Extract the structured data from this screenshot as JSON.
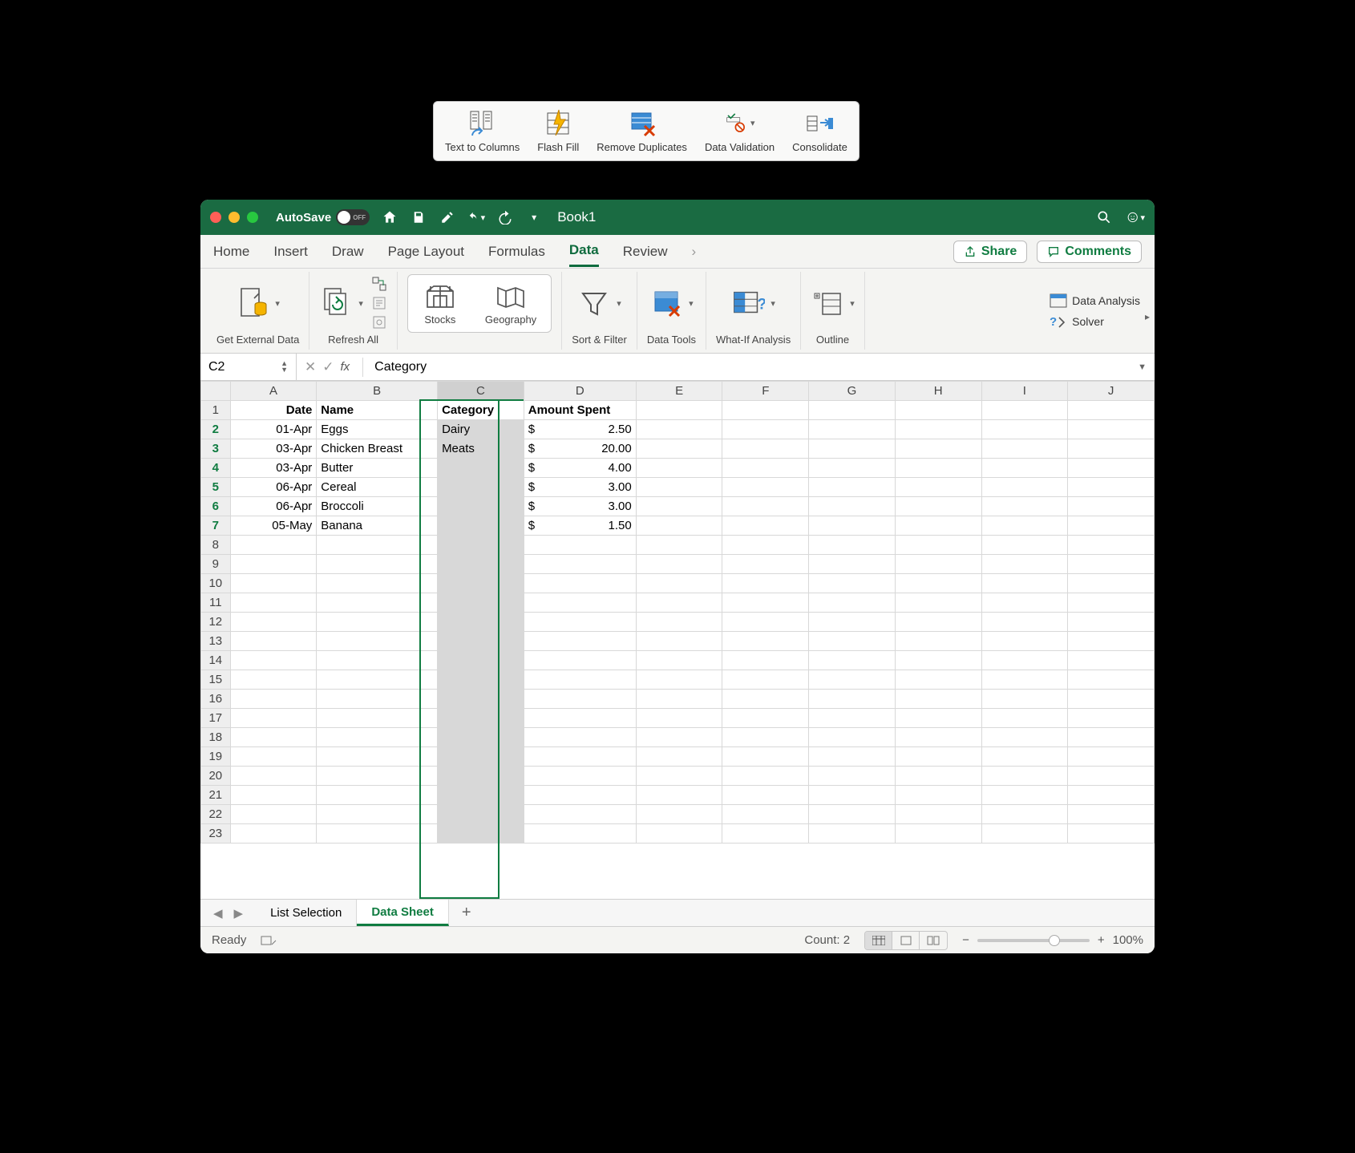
{
  "titlebar": {
    "autosave_label": "AutoSave",
    "autosave_state": "OFF",
    "book_title": "Book1"
  },
  "tabs": {
    "items": [
      "Home",
      "Insert",
      "Draw",
      "Page Layout",
      "Formulas",
      "Data",
      "Review"
    ],
    "active": "Data",
    "share": "Share",
    "comments": "Comments"
  },
  "ribbon": {
    "get_external": "Get External Data",
    "refresh": "Refresh All",
    "stocks": "Stocks",
    "geography": "Geography",
    "sort_filter": "Sort & Filter",
    "data_tools": "Data Tools",
    "whatif": "What-If Analysis",
    "outline": "Outline",
    "data_analysis": "Data Analysis",
    "solver": "Solver"
  },
  "popup": {
    "text_to_columns": "Text to Columns",
    "flash_fill": "Flash Fill",
    "remove_duplicates": "Remove Duplicates",
    "data_validation": "Data Validation",
    "consolidate": "Consolidate"
  },
  "formula_bar": {
    "cell_ref": "C2",
    "value": "Category"
  },
  "columns": [
    "A",
    "B",
    "C",
    "D",
    "E",
    "F",
    "G",
    "H",
    "I",
    "J"
  ],
  "headers": {
    "A": "Date",
    "B": "Name",
    "C": "Category",
    "D": "Amount Spent"
  },
  "rows": [
    {
      "n": 1,
      "A": "Date",
      "B": "Name",
      "C": "Category",
      "D": "Amount Spent",
      "bold": true
    },
    {
      "n": 2,
      "A": "01-Apr",
      "B": "Eggs",
      "C": "Dairy",
      "D_sym": "$",
      "D_val": "2.50"
    },
    {
      "n": 3,
      "A": "03-Apr",
      "B": "Chicken Breast",
      "C": "Meats",
      "D_sym": "$",
      "D_val": "20.00"
    },
    {
      "n": 4,
      "A": "03-Apr",
      "B": "Butter",
      "C": "",
      "D_sym": "$",
      "D_val": "4.00"
    },
    {
      "n": 5,
      "A": "06-Apr",
      "B": "Cereal",
      "C": "",
      "D_sym": "$",
      "D_val": "3.00"
    },
    {
      "n": 6,
      "A": "06-Apr",
      "B": "Broccoli",
      "C": "",
      "D_sym": "$",
      "D_val": "3.00"
    },
    {
      "n": 7,
      "A": "05-May",
      "B": "Banana",
      "C": "",
      "D_sym": "$",
      "D_val": "1.50"
    }
  ],
  "empty_rows": [
    8,
    9,
    10,
    11,
    12,
    13,
    14,
    15,
    16,
    17,
    18,
    19,
    20,
    21,
    22,
    23
  ],
  "sheet_tabs": {
    "inactive": "List Selection",
    "active": "Data Sheet"
  },
  "statusbar": {
    "ready": "Ready",
    "count": "Count: 2",
    "zoom": "100%"
  },
  "colors": {
    "accent": "#107c41",
    "titlebar": "#1a6b42"
  }
}
